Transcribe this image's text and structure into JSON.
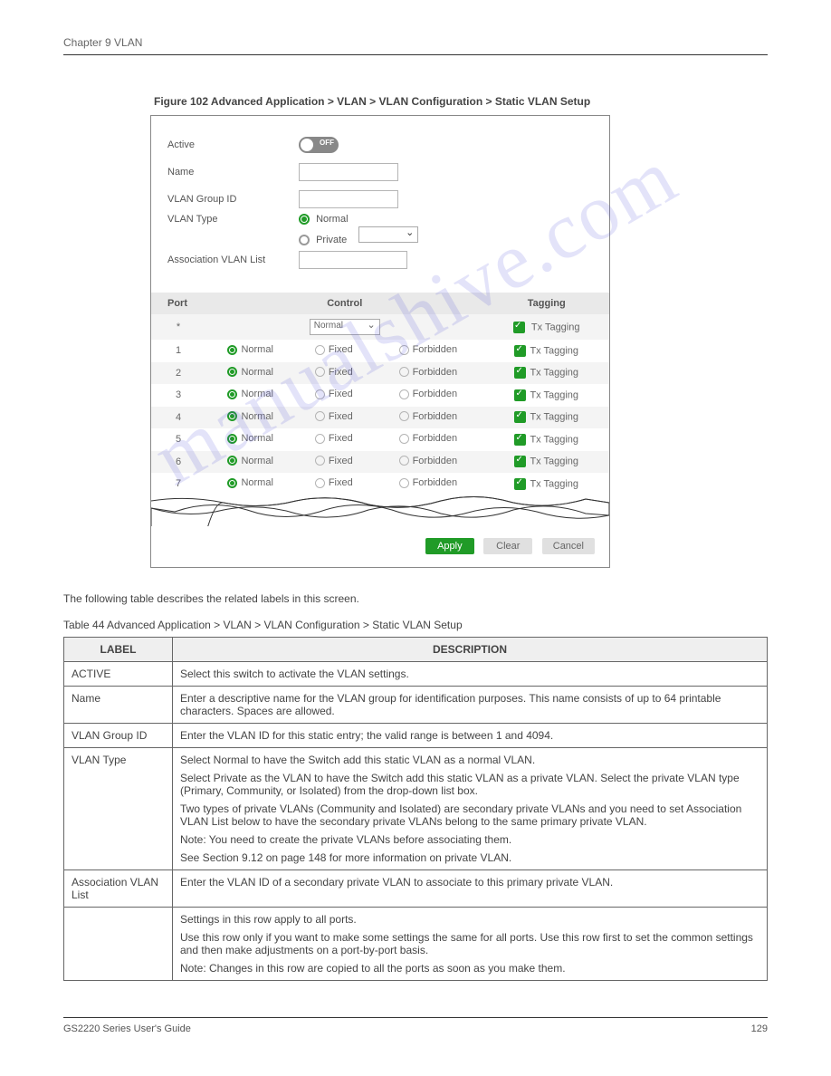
{
  "chapter": "Chapter 9 VLAN",
  "figure_caption": "Figure 102   Advanced Application > VLAN > VLAN Configuration > Static VLAN Setup",
  "form": {
    "active_label": "Active",
    "toggle_text": "OFF",
    "name_label": "Name",
    "group_id_label": "VLAN Group ID",
    "vlan_type_label": "VLAN Type",
    "type_normal": "Normal",
    "type_private": "Private",
    "assoc_label": "Association VLAN List"
  },
  "port_table": {
    "headers": {
      "port": "Port",
      "control": "Control",
      "tagging": "Tagging"
    },
    "star_row": {
      "port": "*",
      "select": "Normal",
      "tag": "Tx Tagging"
    },
    "normal": "Normal",
    "fixed": "Fixed",
    "forbidden": "Forbidden",
    "tag": "Tx Tagging",
    "rows": [
      1,
      2,
      3,
      4,
      5,
      6,
      7
    ]
  },
  "buttons": {
    "apply": "Apply",
    "clear": "Clear",
    "cancel": "Cancel"
  },
  "para": "The following table describes the related labels in this screen.",
  "table_caption": "Table 44   Advanced Application > VLAN > VLAN Configuration > Static VLAN Setup",
  "desc_headers": {
    "label": "LABEL",
    "description": "DESCRIPTION"
  },
  "desc_rows": [
    {
      "label": "ACTIVE",
      "desc": [
        "Select this switch to activate the VLAN settings."
      ]
    },
    {
      "label": "Name",
      "desc": [
        "Enter a descriptive name for the VLAN group for identification purposes. This name consists of up to 64 printable characters. Spaces are allowed."
      ]
    },
    {
      "label": "VLAN Group ID",
      "desc": [
        "Enter the VLAN ID for this static entry; the valid range is between 1 and 4094."
      ]
    },
    {
      "label": "VLAN Type",
      "desc": [
        "Select Normal to have the Switch add this static VLAN as a normal VLAN.",
        "Select Private as the VLAN to have the Switch add this static VLAN as a private VLAN. Select the private VLAN type (Primary, Community, or Isolated) from the drop-down list box.",
        "Two types of private VLANs (Community and Isolated) are secondary private VLANs and you need to set Association VLAN List below to have the secondary private VLANs belong to the same primary private VLAN.",
        "Note: You need to create the private VLANs before associating them.",
        "See Section 9.12 on page 148 for more information on private VLAN."
      ]
    },
    {
      "label": "Association VLAN List",
      "desc": [
        "Enter the VLAN ID of a secondary private VLAN to associate to this primary private VLAN."
      ]
    },
    {
      "label": "",
      "desc": [
        "Settings in this row apply to all ports.",
        "Use this row only if you want to make some settings the same for all ports. Use this row first to set the common settings and then make adjustments on a port-by-port basis.",
        "Note: Changes in this row are copied to all the ports as soon as you make them."
      ]
    }
  ],
  "footer": {
    "left": "GS2220 Series User's Guide",
    "right": "129"
  }
}
